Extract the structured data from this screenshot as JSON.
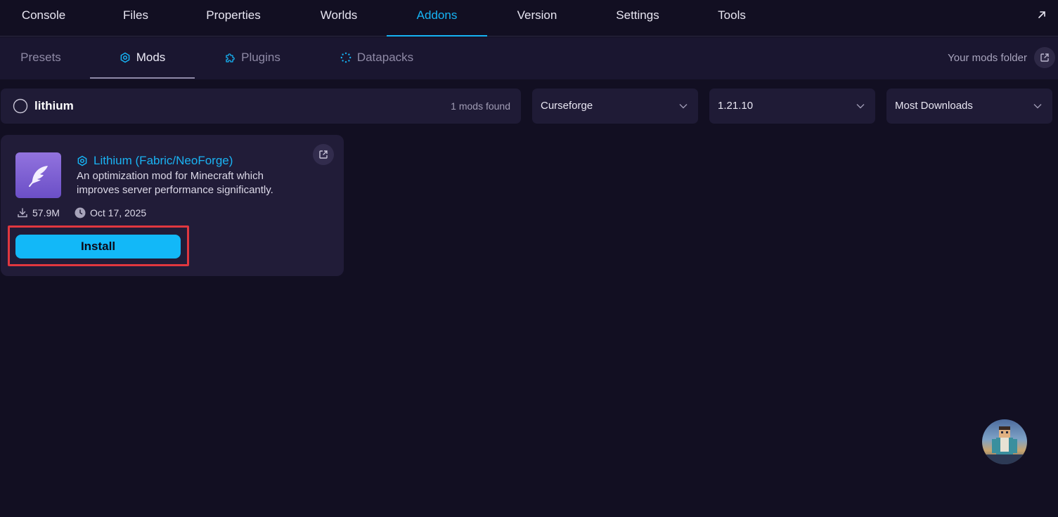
{
  "topnav": {
    "tabs": [
      {
        "label": "Console"
      },
      {
        "label": "Files"
      },
      {
        "label": "Properties"
      },
      {
        "label": "Worlds"
      },
      {
        "label": "Addons",
        "active": true
      },
      {
        "label": "Version"
      },
      {
        "label": "Settings"
      },
      {
        "label": "Tools"
      }
    ],
    "external_icon": "arrow-up-right-icon"
  },
  "subnav": {
    "tabs": [
      {
        "label": "Presets"
      },
      {
        "label": "Mods",
        "icon": "hexagon-gear-icon",
        "active": true
      },
      {
        "label": "Plugins",
        "icon": "puzzle-icon"
      },
      {
        "label": "Datapacks",
        "icon": "dotted-circle-icon"
      }
    ],
    "folder_label": "Your mods folder",
    "folder_icon": "external-link-icon"
  },
  "search": {
    "value": "lithium",
    "results_count": "1 mods found",
    "source": "Curseforge",
    "version": "1.21.10",
    "sort": "Most Downloads"
  },
  "results": [
    {
      "title": "Lithium (Fabric/NeoForge)",
      "description": "An optimization mod for Minecraft which improves server performance significantly.",
      "downloads": "57.9M",
      "date": "Oct 17, 2025",
      "install_label": "Install",
      "icon": "feather-icon"
    }
  ],
  "colors": {
    "accent": "#16b4f5",
    "background": "#120f22",
    "card": "#211c38",
    "highlight": "#e0373f"
  }
}
